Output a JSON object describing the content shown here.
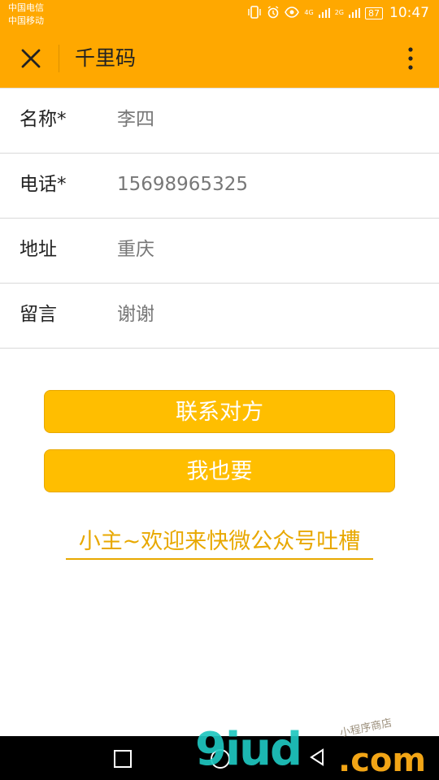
{
  "status_bar": {
    "carrier_1": "中国电信",
    "carrier_2": "中国移动",
    "net_1": "4G",
    "net_2": "2G",
    "net_3": "2G",
    "battery": "87",
    "time": "10:47"
  },
  "header": {
    "title": "千里码",
    "close_icon": "close-icon",
    "more_icon": "more-vertical-icon",
    "background": "#FFA800"
  },
  "form": {
    "rows": [
      {
        "label": "名称*",
        "value": "李四"
      },
      {
        "label": "电话*",
        "value": "15698965325"
      },
      {
        "label": "地址",
        "value": "重庆"
      },
      {
        "label": "留言",
        "value": "谢谢"
      }
    ]
  },
  "actions": {
    "contact_label": "联系对方",
    "want_label": "我也要",
    "button_color": "#FFBE00"
  },
  "link": {
    "text": "小主~欢迎来快微公众号吐槽",
    "color": "#E8A800"
  },
  "watermark": {
    "main": "9iud",
    "suffix": ".com",
    "small": "小程序商店"
  }
}
